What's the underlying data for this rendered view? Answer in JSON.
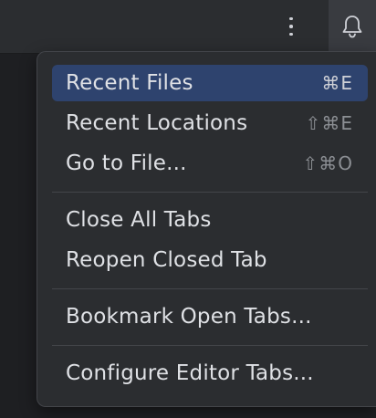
{
  "toolbar": {
    "more_icon": "more-vertical-icon",
    "bell_icon": "bell-icon"
  },
  "menu": {
    "items": [
      {
        "label": "Recent Files",
        "shortcut": "⌘E",
        "selected": true
      },
      {
        "label": "Recent Locations",
        "shortcut": "⇧⌘E"
      },
      {
        "label": "Go to File...",
        "shortcut": "⇧⌘O"
      },
      {
        "label": "Close All Tabs",
        "shortcut": ""
      },
      {
        "label": "Reopen Closed Tab",
        "shortcut": ""
      },
      {
        "label": "Bookmark Open Tabs...",
        "shortcut": ""
      },
      {
        "label": "Configure Editor Tabs...",
        "shortcut": ""
      }
    ]
  },
  "colors": {
    "background": "#1e1f22",
    "toolbar": "#2b2d30",
    "menu_bg": "#2b2d30",
    "selection": "#2e436e",
    "text": "#dfe1e5",
    "shortcut_text": "#8c8f94"
  }
}
